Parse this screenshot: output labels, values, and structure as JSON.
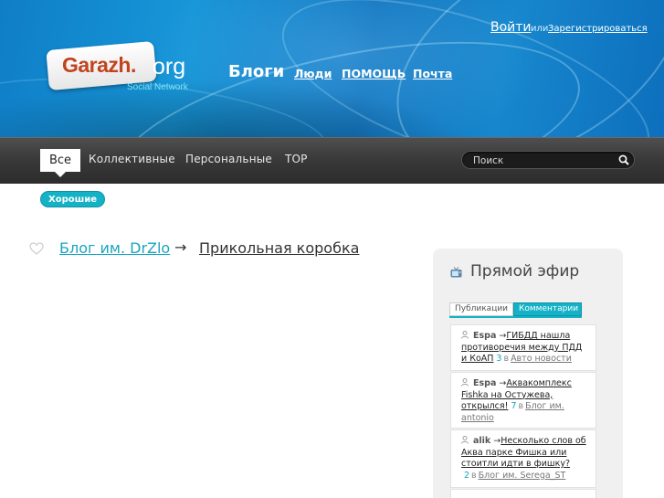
{
  "logo": {
    "brand": "Garazh.",
    "tld": "org",
    "tagline": "Social Network"
  },
  "nav": {
    "current": "Блоги",
    "links": [
      "Люди",
      "ПОМОЩЬ",
      "Почта"
    ]
  },
  "auth": {
    "login": "Войти",
    "or": "или",
    "register": "Зарегистрироваться"
  },
  "toolbar": {
    "active_tab": "Все",
    "tabs": [
      "Коллективные",
      "Персональные",
      "TOP"
    ],
    "search_placeholder": "Поиск"
  },
  "filter": {
    "active": "Хорошие"
  },
  "post": {
    "blog": "Блог им. DrZlo",
    "arrow": "→",
    "title": "Прикольная коробка"
  },
  "live": {
    "title": "Прямой эфир",
    "tabs": [
      "Публикации",
      "Комментарии"
    ],
    "active_tab": "Комментарии",
    "items": [
      {
        "author": "Espa",
        "arrow": "→",
        "title": "ГИБДД нашла противоречия между ПДД и КоАП",
        "count": "3",
        "in": "в",
        "blog": "Авто новости"
      },
      {
        "author": "Espa",
        "arrow": "→",
        "title": "Аквакомплекс Fishka на Остужева, открылся!",
        "count": "7",
        "in": "в",
        "blog": "Блог им. antonio"
      },
      {
        "author": "alik",
        "arrow": "→",
        "title": "Несколько слов об Аква парке Фишка или стоитли идти в фишку?",
        "count": "2",
        "in": "в",
        "blog": "Блог им. Serega_ST"
      }
    ]
  },
  "colors": {
    "accent": "#14b2c6",
    "header": "#1284cc",
    "toolbar": "#3a3a3a"
  }
}
